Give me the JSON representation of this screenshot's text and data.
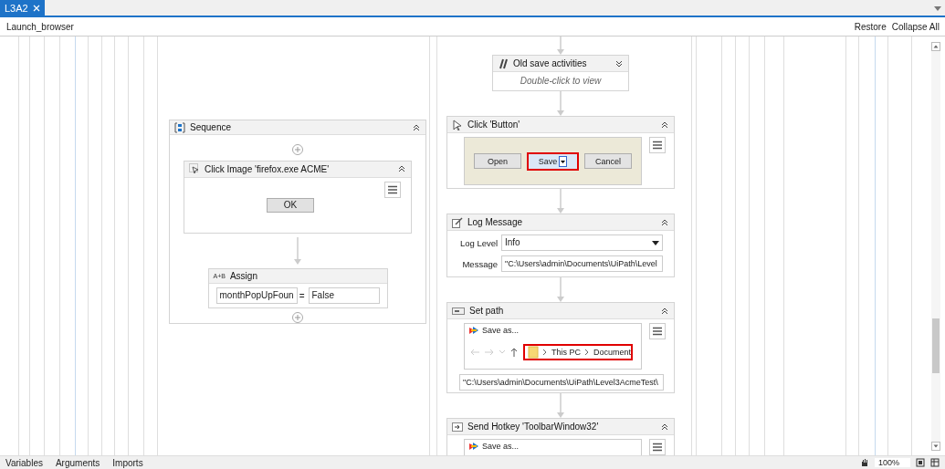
{
  "tab": {
    "label": "L3A2",
    "selected": true
  },
  "breadcrumb": "Launch_browser",
  "actions": [
    "Restore",
    "Collapse All"
  ],
  "columns": [
    {
      "activities": [
        {
          "kind": "sequence",
          "title": "Sequence",
          "expanded": true,
          "children": [
            {
              "kind": "click_image",
              "title": "Click Image 'firefox.exe ACME'",
              "expanded": true,
              "image_button": "OK"
            },
            {
              "kind": "assign",
              "title": "Assign",
              "badge": "A+B",
              "to": "monthPopUpFoun",
              "operator": "=",
              "value": "False"
            }
          ]
        }
      ]
    },
    {
      "activities": [
        {
          "kind": "collapsed",
          "title": "Old save activities",
          "expanded": false,
          "hint": "Double-click to view"
        },
        {
          "kind": "click_button",
          "title": "Click 'Button'",
          "expanded": true,
          "buttons": [
            {
              "label": "Open",
              "highlighted": false
            },
            {
              "label": "Save",
              "highlighted": true
            },
            {
              "label": "Cancel",
              "highlighted": false
            }
          ]
        },
        {
          "kind": "log_message",
          "title": "Log Message",
          "expanded": true,
          "level_label": "Log Level",
          "log_level": "Info",
          "message_label": "Message",
          "message": "\"C:\\Users\\admin\\Documents\\UiPath\\Level"
        },
        {
          "kind": "set_path",
          "title": "Set path",
          "expanded": true,
          "window_title": "Save as...",
          "crumbs": [
            "This PC",
            "Document"
          ],
          "path": "\"C:\\Users\\admin\\Documents\\UiPath\\Level3AcmeTest\\"
        },
        {
          "kind": "send_hotkey",
          "title": "Send Hotkey 'ToolbarWindow32'",
          "expanded": true,
          "window_title": "Save as..."
        }
      ]
    }
  ],
  "bottom_tabs": [
    "Variables",
    "Arguments",
    "Imports"
  ],
  "zoom": "100%"
}
